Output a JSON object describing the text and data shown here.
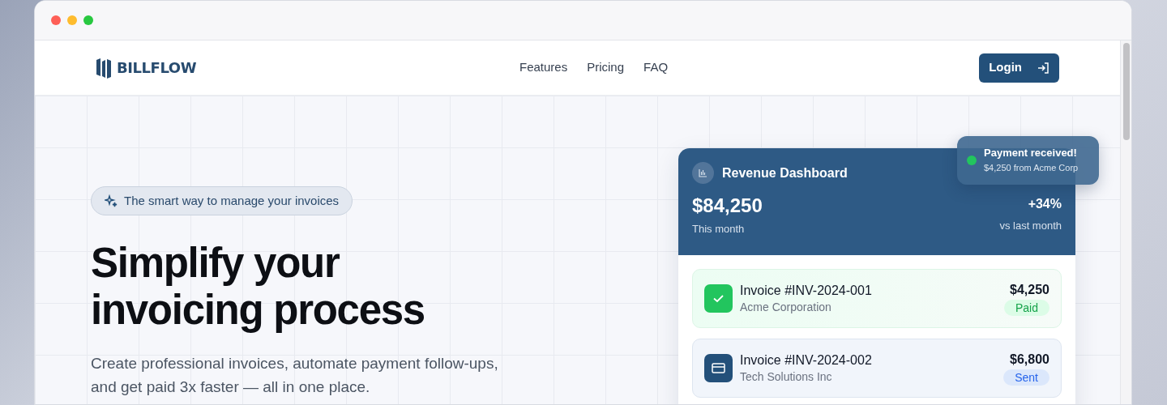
{
  "nav": {
    "brand": "BILLFLOW",
    "links": [
      "Features",
      "Pricing",
      "FAQ"
    ],
    "login": "Login"
  },
  "hero": {
    "badge": "The smart way to manage your invoices",
    "title_lines": [
      "Simplify your",
      "invoicing process"
    ],
    "subtitle_lines": [
      "Create professional invoices, automate payment follow-ups,",
      "and get paid 3x faster — all in one place."
    ]
  },
  "dashboard": {
    "title": "Revenue Dashboard",
    "amount": "$84,250",
    "amount_label": "This month",
    "change": "+34%",
    "change_label": "vs last month",
    "invoices": [
      {
        "kind": "paid",
        "number": "Invoice #INV-2024-001",
        "client": "Acme Corporation",
        "amount": "$4,250",
        "status": "Paid"
      },
      {
        "kind": "sent",
        "number": "Invoice #INV-2024-002",
        "client": "Tech Solutions Inc",
        "amount": "$6,800",
        "status": "Sent"
      }
    ]
  },
  "toast": {
    "title": "Payment received!",
    "detail": "$4,250 from Acme Corp",
    "color": "#22c55e"
  }
}
